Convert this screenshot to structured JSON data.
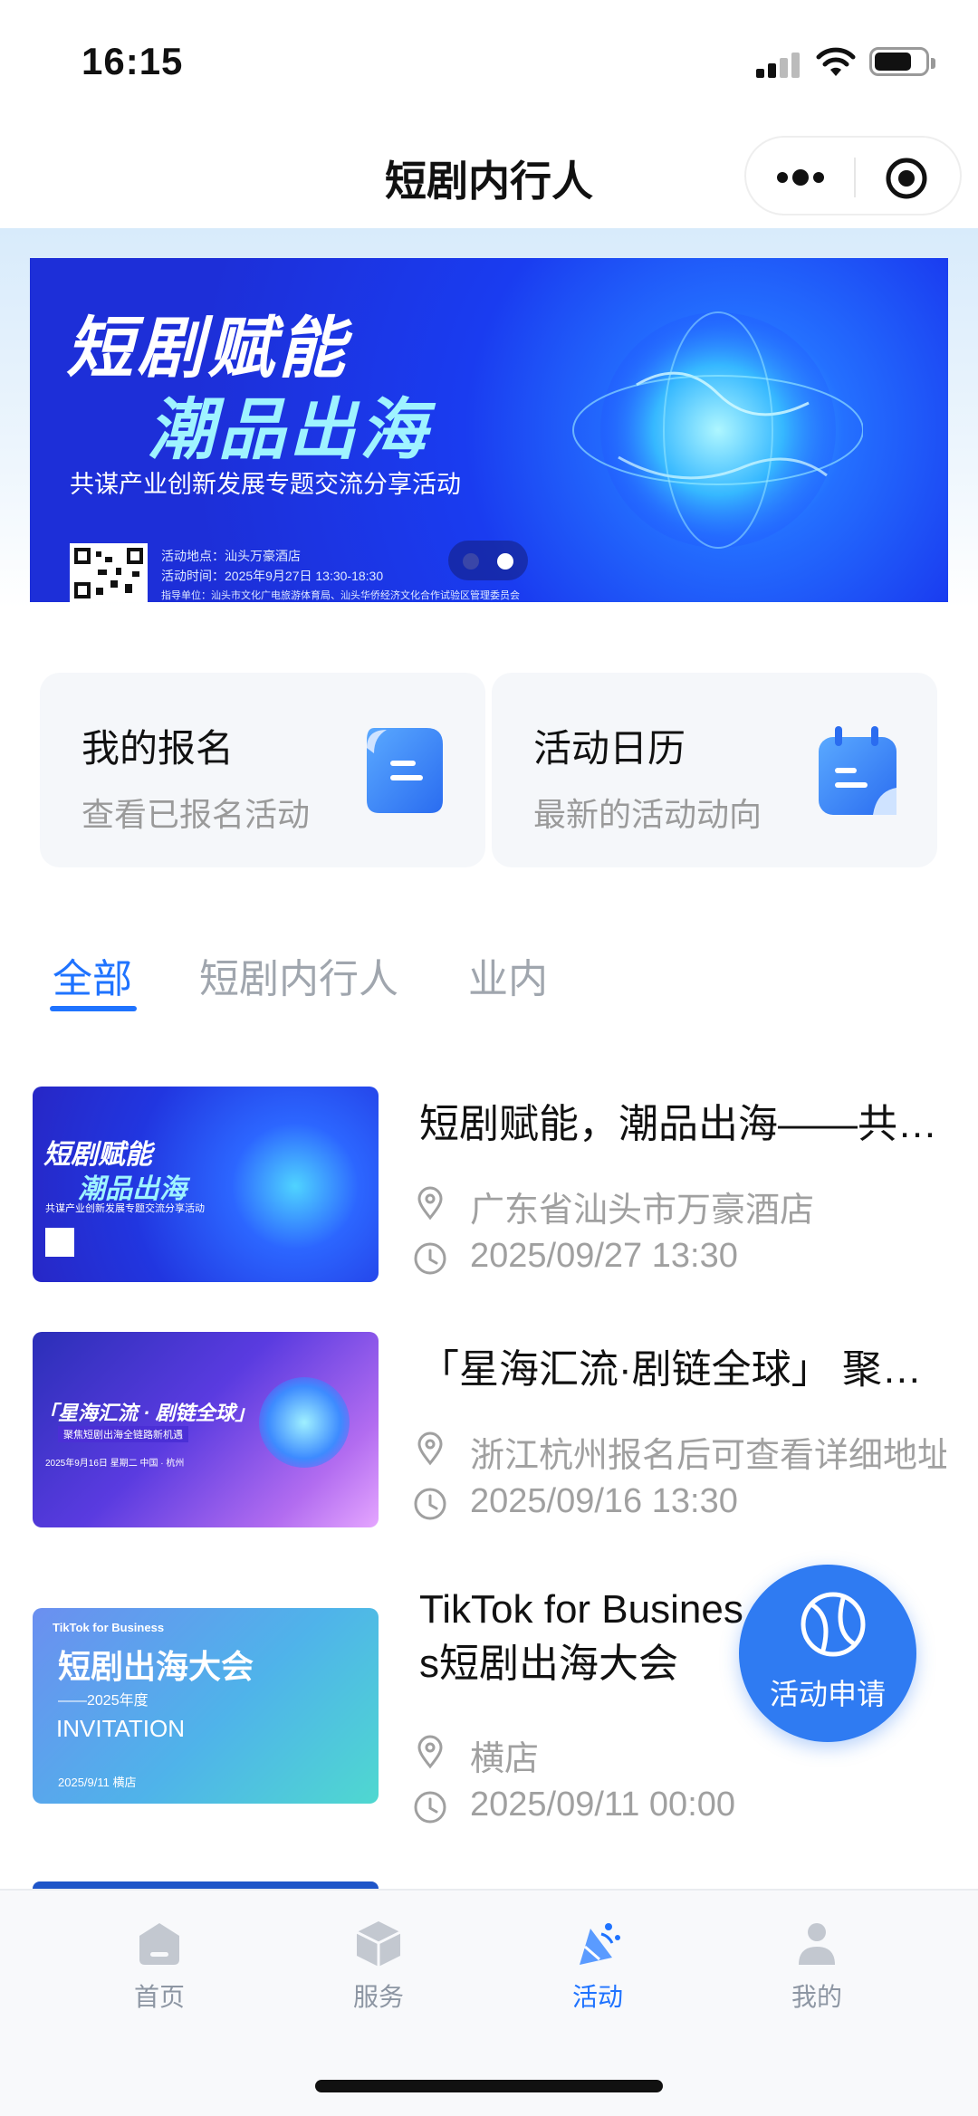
{
  "status_bar": {
    "time": "16:15"
  },
  "nav": {
    "title": "短剧内行人"
  },
  "banner": {
    "title_line1": "短剧赋能",
    "title_line2": "潮品出海",
    "subtitle": "共谋产业创新发展专题交流分享活动",
    "info_line1": "活动地点：汕头万豪酒店",
    "info_line2": "活动时间：2025年9月27日 13:30-18:30",
    "info_line3": "指导单位：汕头市文化广电旅游体育局、汕头华侨经济文化合作试验区管理委员会",
    "slide_count": 2,
    "active_slide": 2
  },
  "quick_cards": [
    {
      "title": "我的报名",
      "subtitle": "查看已报名活动",
      "icon": "registration-doc-icon"
    },
    {
      "title": "活动日历",
      "subtitle": "最新的活动动向",
      "icon": "calendar-icon"
    }
  ],
  "tabs": [
    {
      "label": "全部",
      "active": true
    },
    {
      "label": "短剧内行人",
      "active": false
    },
    {
      "label": "业内",
      "active": false
    }
  ],
  "events": [
    {
      "title": "短剧赋能，潮品出海——共谋产业创新发展专题交流分享活动",
      "location": "广东省汕头市万豪酒店",
      "datetime": "2025/09/27 13:30",
      "thumb_line1": "短剧赋能",
      "thumb_line2": "潮品出海",
      "thumb_sub": "共谋产业创新发展专题交流分享活动"
    },
    {
      "title": "「星海汇流·剧链全球」 聚焦短剧出海全链路新机遇",
      "location": "浙江杭州报名后可查看详细地址",
      "datetime": "2025/09/16 13:30",
      "thumb_line1": "「星海汇流 · 剧链全球」",
      "thumb_sub": "聚焦短剧出海全链路新机遇",
      "thumb_date": "2025年9月16日 星期二  中国 · 杭州"
    },
    {
      "title": "TikTok for Business短剧出海大会",
      "location": "横店",
      "datetime": "2025/09/11 00:00",
      "thumb_brand": "TikTok for Business",
      "thumb_line1": "短剧出海大会",
      "thumb_line2": "——2025年度",
      "thumb_line3": "INVITATION",
      "thumb_date": "2025/9/11 横店"
    }
  ],
  "fab": {
    "label": "活动申请",
    "icon": "tennis-ball-icon"
  },
  "tabbar": [
    {
      "label": "首页",
      "icon": "home-icon",
      "active": false
    },
    {
      "label": "服务",
      "icon": "box-icon",
      "active": false
    },
    {
      "label": "活动",
      "icon": "party-icon",
      "active": true
    },
    {
      "label": "我的",
      "icon": "user-icon",
      "active": false
    }
  ],
  "colors": {
    "accent": "#1f73ff",
    "inactive": "#8d96a3",
    "fab": "#2f7bf2"
  }
}
